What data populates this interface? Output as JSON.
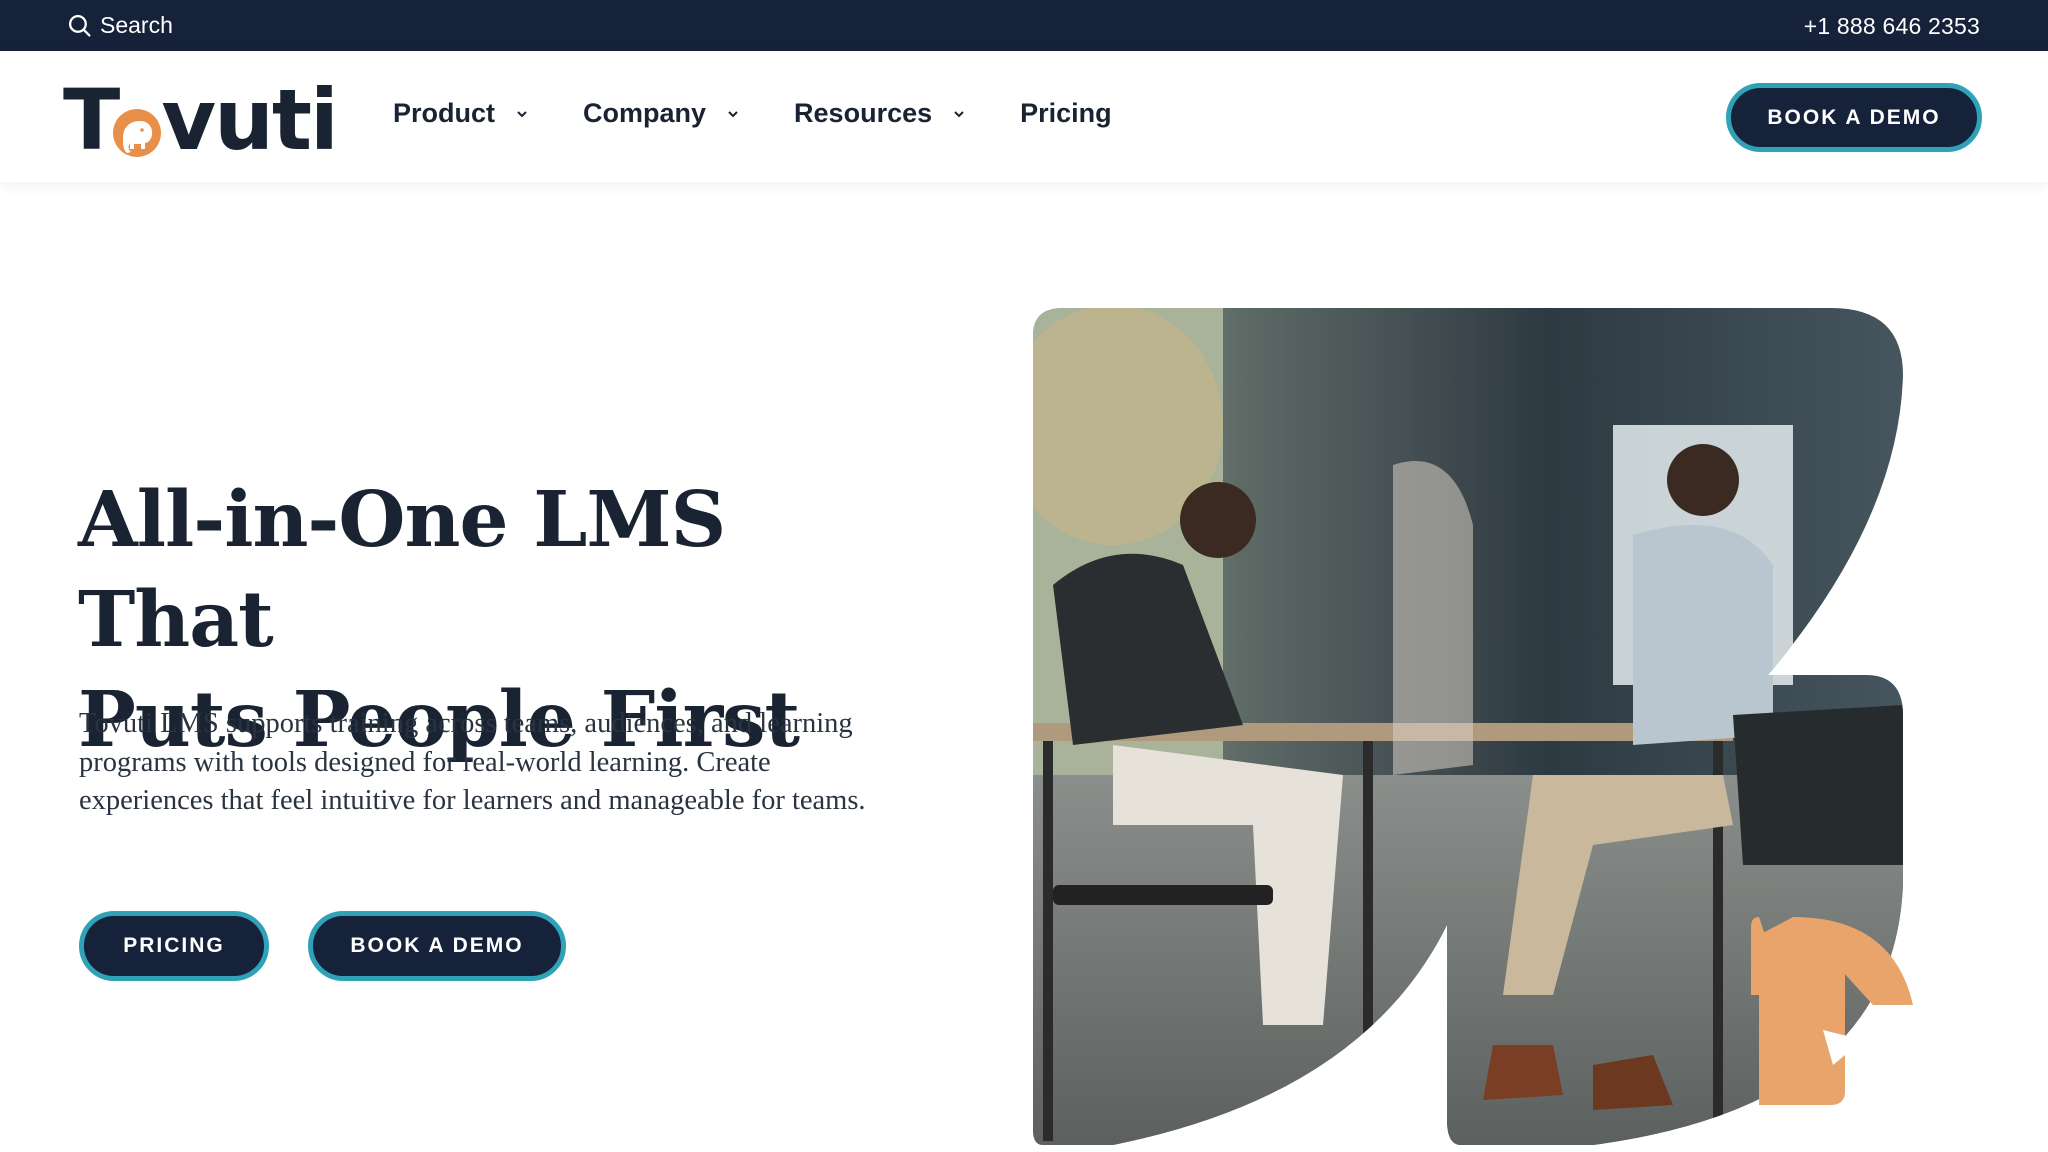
{
  "topbar": {
    "search_label": "Search",
    "phone": "+1 888 646 2353"
  },
  "nav": {
    "logo_text_before": "T",
    "logo_text_after": "vuti",
    "items": [
      {
        "label": "Product",
        "has_dropdown": true
      },
      {
        "label": "Company",
        "has_dropdown": true
      },
      {
        "label": "Resources",
        "has_dropdown": true
      },
      {
        "label": "Pricing",
        "has_dropdown": false
      }
    ],
    "cta_label": "BOOK A DEMO"
  },
  "hero": {
    "title_line1": "All-in-One LMS That",
    "title_line2": "Puts People First",
    "subtitle": "Tovuti LMS supports training across teams, audiences, and learning programs with tools designed for real-world learning. Create experiences that feel intuitive for learners and manageable for teams.",
    "primary_button": "PRICING",
    "secondary_button": "BOOK A DEMO"
  },
  "colors": {
    "dark_navy": "#16213a",
    "teal_outline": "#2fa2b8",
    "brand_orange": "#e8904a",
    "text_dark": "#1a2332"
  },
  "icons": {
    "search": "search-icon",
    "chevron": "chevron-down-icon",
    "logo_mark": "elephant-icon"
  }
}
